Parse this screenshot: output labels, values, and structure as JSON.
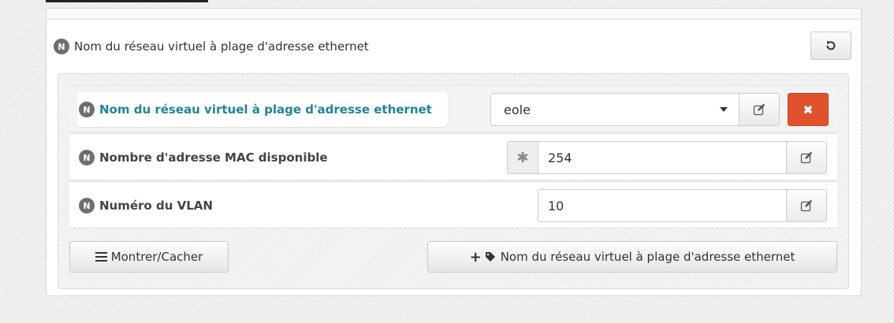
{
  "section": {
    "badge": "N",
    "title": "Nom du réseau virtuel à plage d'adresse ethernet"
  },
  "reset_icon": "reset-icon",
  "rows": [
    {
      "badge": "N",
      "label": "Nom du réseau virtuel à plage d'adresse ethernet",
      "value": "eole",
      "field_type": "select"
    },
    {
      "badge": "N",
      "label": "Nombre d'adresse MAC disponible",
      "value": "254",
      "addon": "✱",
      "field_type": "text"
    },
    {
      "badge": "N",
      "label": "Numéro du VLAN",
      "value": "10",
      "field_type": "text"
    }
  ],
  "buttons": {
    "toggle_label": "Montrer/Cacher",
    "add_label": "Nom du réseau virtuel à plage d'adresse ethernet"
  },
  "colors": {
    "accent": "#23849b",
    "danger": "#e2512e",
    "badge": "#6f6f6f"
  },
  "icons": [
    "reset-icon",
    "caret-down-icon",
    "edit-icon",
    "close-icon",
    "asterisk-icon",
    "menu-icon",
    "plus-icon",
    "tag-icon"
  ]
}
